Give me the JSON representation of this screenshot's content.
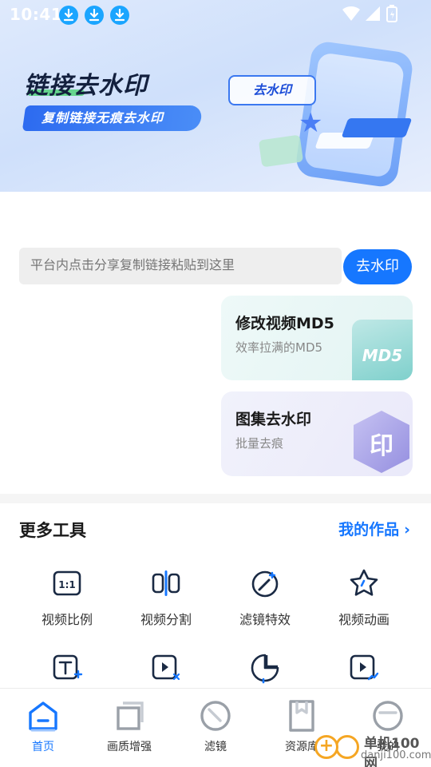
{
  "status_bar": {
    "time": "10:41"
  },
  "banner": {
    "title": "链接去水印",
    "subtitle": "复制链接无痕去水印",
    "tag": "去水印"
  },
  "search": {
    "placeholder": "平台内点击分享复制链接粘贴到这里",
    "button": "去水印"
  },
  "feature_cards": [
    {
      "title": "修改视频MD5",
      "subtitle": "效率拉满的MD5",
      "badge": "MD5"
    },
    {
      "title": "图集去水印",
      "subtitle": "批量去痕",
      "badge": "印"
    }
  ],
  "more_tools": {
    "title": "更多工具",
    "my_works": "我的作品",
    "tools": [
      {
        "label": "视频比例",
        "icon": "aspect-ratio-icon"
      },
      {
        "label": "视频分割",
        "icon": "split-icon"
      },
      {
        "label": "滤镜特效",
        "icon": "filter-effect-icon"
      },
      {
        "label": "视频动画",
        "icon": "star-animation-icon"
      }
    ],
    "tools_row2_icons": [
      "add-text-icon",
      "video-cut-icon",
      "sticker-icon",
      "video-trend-icon"
    ]
  },
  "bottom_nav": [
    {
      "label": "首页",
      "icon": "home-icon",
      "active": true
    },
    {
      "label": "画质增强",
      "icon": "enhance-icon",
      "active": false
    },
    {
      "label": "滤镜",
      "icon": "filter-icon",
      "active": false
    },
    {
      "label": "资源库",
      "icon": "bookmark-icon",
      "active": false
    },
    {
      "label": "我的",
      "icon": "profile-icon",
      "active": false
    }
  ],
  "watermark": {
    "line1": "单机100网",
    "line2": "danji100.com"
  },
  "colors": {
    "accent": "#1677ff",
    "banner_bg": "#dfeafc"
  }
}
